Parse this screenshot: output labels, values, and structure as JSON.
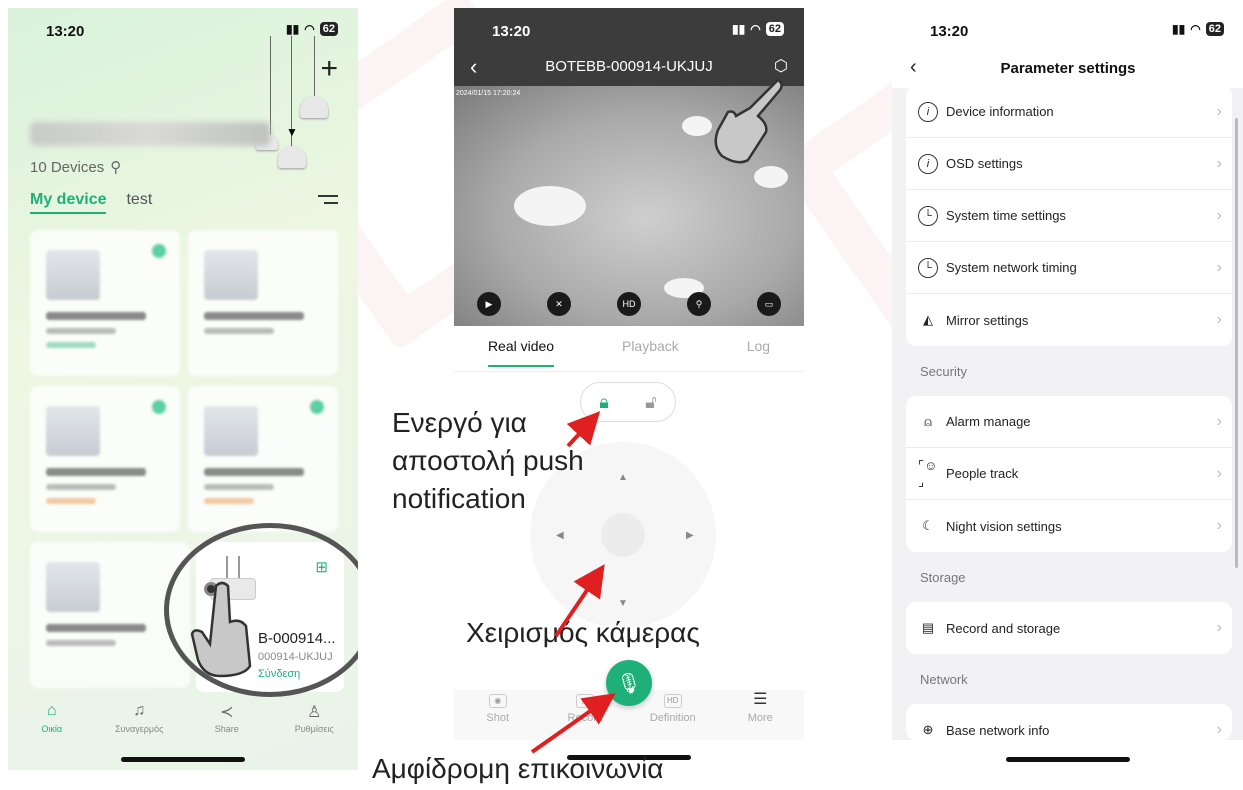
{
  "status_time": "13:20",
  "battery": "62",
  "phone1": {
    "devices_count": "10 Devices",
    "tabs": [
      "My device",
      "test"
    ],
    "focused_device": {
      "name": "B-000914...",
      "sub": "000914-UKJUJ",
      "status": "Σύνδεση"
    },
    "nav": [
      "Οικία",
      "Συναγερμός",
      "Share",
      "Ρυθμίσεις"
    ]
  },
  "phone2": {
    "title": "BOTEBB-000914-UKJUJ",
    "timestamp": "2024/01/15 17:20:24",
    "video_buttons": [
      "HD"
    ],
    "tabs": [
      "Real video",
      "Playback",
      "Log"
    ],
    "toolbar": [
      "Shot",
      "Record",
      "Definition",
      "More"
    ],
    "definition_badge": "HD"
  },
  "phone3": {
    "title": "Parameter settings",
    "group1": [
      "Device information",
      "OSD settings",
      "System time settings",
      "System network timing",
      "Mirror settings"
    ],
    "section_security": "Security",
    "group2": [
      "Alarm manage",
      "People track",
      "Night vision settings"
    ],
    "section_storage": "Storage",
    "group3": [
      "Record and storage"
    ],
    "section_network": "Network",
    "group4": [
      "Base network info"
    ]
  },
  "annotations": {
    "push_notification": [
      "Ενεργό για",
      "αποστολή push",
      "notification"
    ],
    "camera_control": "Χειρισμός κάμερας",
    "two_way": "Αμφίδρομη επικοινωνία"
  },
  "colors": {
    "accent": "#1fb07a",
    "annotation_arrow": "#e02020",
    "topbar": "#3c3c3c"
  },
  "icons": [
    "home-icon",
    "bell-icon",
    "share-icon",
    "user-icon",
    "lock-icon",
    "unlock-icon",
    "mic-icon",
    "camera-icon",
    "record-icon",
    "more-icon",
    "info-icon",
    "clock-icon",
    "mirror-icon",
    "alarm-icon",
    "person-icon",
    "moon-icon",
    "sd-card-icon",
    "globe-icon",
    "chevron-right-icon",
    "pointing-hand-icon"
  ]
}
